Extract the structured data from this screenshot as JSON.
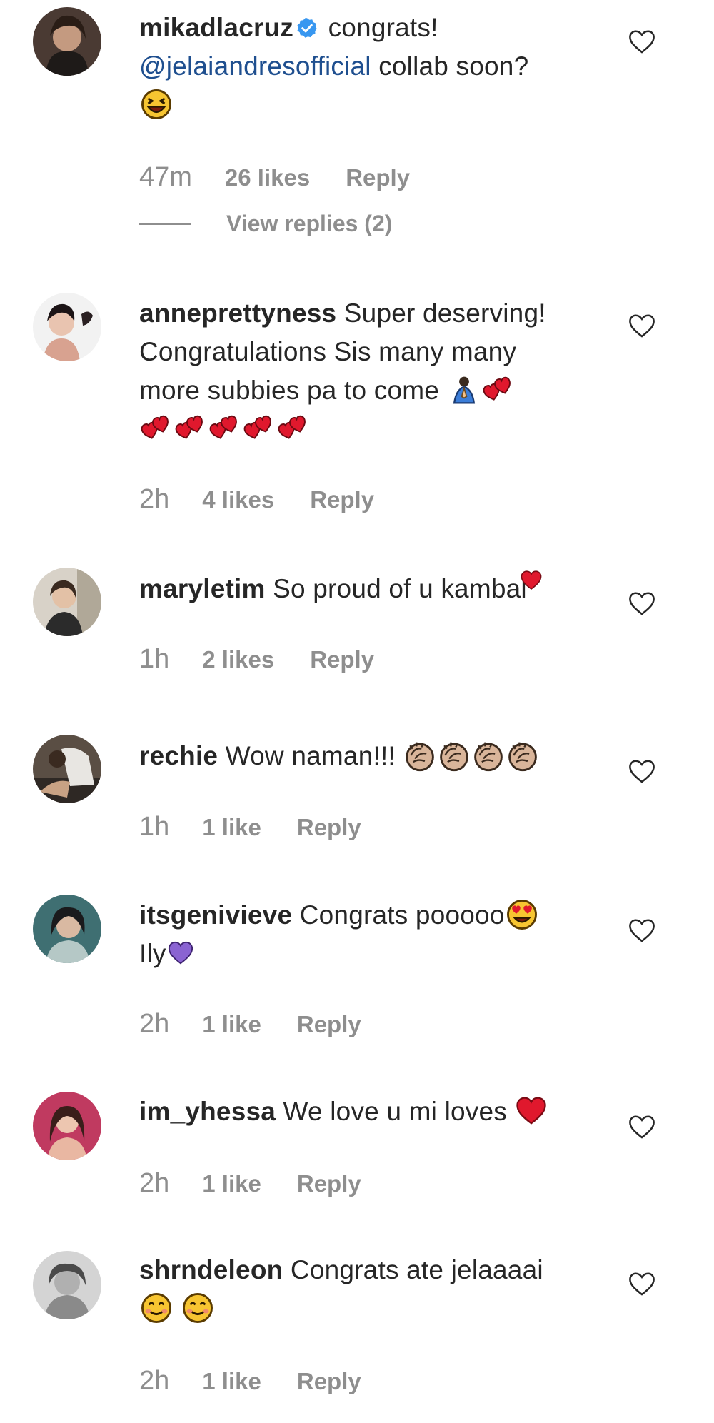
{
  "comments": [
    {
      "username": "mikadlacruz",
      "verified": true,
      "text_before": "congrats!",
      "mention": "@jelaiandresofficial",
      "text_after": "collab soon?",
      "time": "47m",
      "likes": "26 likes",
      "reply": "Reply",
      "view_replies": "View replies (2)"
    },
    {
      "username": "anneprettyness",
      "text_line1": "Super deserving!",
      "text_line2": "Congratulations Sis many many",
      "text_line3": "more subbies pa to come",
      "time": "2h",
      "likes": "4 likes",
      "reply": "Reply"
    },
    {
      "username": "maryletim",
      "text": "So proud of u kambal",
      "time": "1h",
      "likes": "2 likes",
      "reply": "Reply"
    },
    {
      "username": "rechie",
      "text": "Wow naman!!!",
      "time": "1h",
      "likes": "1 like",
      "reply": "Reply"
    },
    {
      "username": "itsgenivieve",
      "text_line1": "Congrats pooooo",
      "text_line2": "Ily",
      "time": "2h",
      "likes": "1 like",
      "reply": "Reply"
    },
    {
      "username": "im_yhessa",
      "text": "We love u mi loves",
      "time": "2h",
      "likes": "1 like",
      "reply": "Reply"
    },
    {
      "username": "shrndeleon",
      "text": "Congrats ate jelaaaai",
      "time": "2h",
      "likes": "1 like",
      "reply": "Reply"
    }
  ],
  "colors": {
    "text": "#262626",
    "meta": "#8e8e8e",
    "mention": "#1f4f8f",
    "verified": "#3897f0"
  }
}
